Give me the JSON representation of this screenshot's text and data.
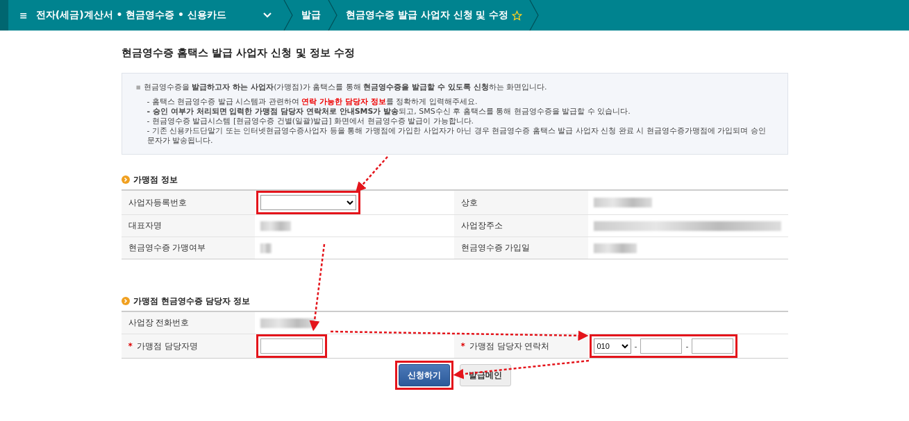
{
  "topbar": {
    "menu_icon": "≡",
    "menu_label": "전자(세금)계산서 • 현금영수증 • 신용카드",
    "crumbs": [
      "발급",
      "현금영수증 발급 사업자 신청 및 수정"
    ]
  },
  "page_title": "현금영수증 홈택스 발급 사업자 신청 및 정보 수정",
  "info": {
    "bullet": "▪",
    "lead": "현금영수증을 **발급하고자 하는 사업자**(가맹점)가 홈택스를 통해 **현금영수증을 발급할 수 있도록 신청**하는 화면입니다.",
    "notes": [
      [
        {
          "text": "- 홈택스 현금영수증 발급 시스템과 관련하여 ",
          "kind": "plain"
        },
        {
          "text": "연락 가능한 담당자 정보",
          "kind": "alert"
        },
        {
          "text": "를 정확하게 입력해주세요.",
          "kind": "plain"
        }
      ],
      [
        {
          "text": "- 승인 여부가 처리되면 입력한 가맹점 담당자 연락처로 안내SMS가 발송",
          "kind": "bold"
        },
        {
          "text": "되고, SMS수신 후 홈택스를 통해 현금영수증을 발급할 수 있습니다.",
          "kind": "plain"
        }
      ],
      [
        {
          "text": "- 현금영수증 발급시스템 [현금영수증 건별(일괄)발급] 화면에서 현금영수증 발급이 가능합니다.",
          "kind": "plain"
        }
      ],
      [
        {
          "text": "- 기존 신용카드단말기 또는 인터넷현금영수증사업자 등을 통해 가맹점에 가입한 사업자가 아닌 경우 현금영수증 홈택스 발급 사업자 신청 완료 시 현금영수증가맹점에 가입되며 승인문자가 발송됩니다.",
          "kind": "plain"
        }
      ]
    ]
  },
  "sections": [
    {
      "title": "가맹점 정보",
      "rows": [
        [
          {
            "label": "사업자등록번호",
            "value": {
              "kind": "select",
              "highlighted": true
            }
          },
          {
            "label": "상호",
            "value": {
              "kind": "redacted"
            }
          }
        ],
        [
          {
            "label": "대표자명",
            "value": {
              "kind": "redacted"
            }
          },
          {
            "label": "사업장주소",
            "value": {
              "kind": "redacted"
            }
          }
        ],
        [
          {
            "label": "현금영수증 가맹여부",
            "value": {
              "kind": "redacted"
            }
          },
          {
            "label": "현금영수증 가입일",
            "value": {
              "kind": "redacted"
            }
          }
        ]
      ]
    },
    {
      "title": "가맹점 현금영수증 담당자 정보",
      "rows": [
        [
          {
            "label": "사업장 전화번호",
            "value": {
              "kind": "redacted"
            }
          }
        ],
        [
          {
            "label": "가맹점 담당자명",
            "required_mark": "*",
            "value": {
              "kind": "input",
              "highlighted": true
            }
          },
          {
            "label": "가맹점 담당자 연락처",
            "required_mark": "*",
            "value": {
              "kind": "phone",
              "prefix": "010",
              "separator": "-",
              "highlighted": true
            }
          }
        ]
      ]
    }
  ],
  "buttons": [
    {
      "label": "신청하기",
      "kind": "primary",
      "highlighted": true
    },
    {
      "label": "발급메인",
      "kind": "secondary",
      "highlighted": false
    }
  ]
}
